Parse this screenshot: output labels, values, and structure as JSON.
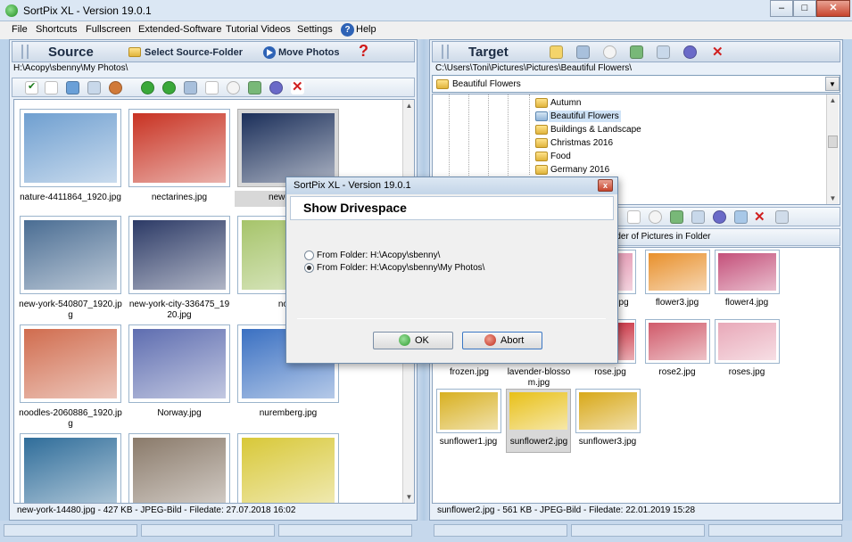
{
  "window": {
    "title": "SortPix XL - Version 19.0.1",
    "min_label": "–",
    "max_label": "□",
    "close_label": "✕"
  },
  "menu": {
    "items": [
      "File",
      "Shortcuts",
      "Fullscreen",
      "Extended-Software",
      "Tutorial Videos",
      "Settings",
      "Help"
    ],
    "help_icon_label": "?"
  },
  "source": {
    "title": "Source",
    "select_button": "Select Source-Folder",
    "move_button": "Move Photos",
    "question_label": "?",
    "path": "H:\\Acopy\\sbenny\\My Photos\\",
    "status": "new-york-14480.jpg - 427 KB - JPEG-Bild - Filedate: 27.07.2018 16:02",
    "thumbnails": [
      {
        "caption": "nature-4411864_1920.jpg",
        "color": "#6f9fd0"
      },
      {
        "caption": "nectarines.jpg",
        "color": "#c83222"
      },
      {
        "caption": "new-york-",
        "color": "#1b2f5a",
        "selected": true
      },
      {
        "caption": "new-york-540807_1920.jp g",
        "color": "#4a6d93"
      },
      {
        "caption": "new-york-city-336475_19 20.jpg",
        "color": "#2c3a66"
      },
      {
        "caption": "nood",
        "color": "#a6c46a"
      },
      {
        "caption": "noodles-2060886_1920.jp g",
        "color": "#d06c4e"
      },
      {
        "caption": "Norway.jpg",
        "color": "#5e6db0"
      },
      {
        "caption": "nuremberg.jpg",
        "color": "#3a70c2"
      },
      {
        "caption": "",
        "color": "#2f6d9a"
      },
      {
        "caption": "",
        "color": "#8a7a6a"
      },
      {
        "caption": "",
        "color": "#d8c838"
      }
    ]
  },
  "target": {
    "title": "Target",
    "path": "C:\\Users\\Toni\\Pictures\\Pictures\\Beautiful Flowers\\",
    "dropdown_value": "Beautiful Flowers",
    "tree_items": [
      "Autumn",
      "Beautiful Flowers",
      "Buildings & Landscape",
      "Christmas 2016",
      "Food",
      "Germany 2016"
    ],
    "order_label": "rder of Pictures in Folder",
    "status": "sunflower2.jpg - 561 KB - JPEG-Bild - Filedate: 22.01.2019 15:28",
    "thumbnails": [
      {
        "caption": "jpg",
        "color": "#e08aa8"
      },
      {
        "caption": "flower3.jpg",
        "color": "#e8902c"
      },
      {
        "caption": "flower4.jpg",
        "color": "#c4507a"
      },
      {
        "caption": "frozen.jpg",
        "color": "#8aa8c8"
      },
      {
        "caption": "lavender-blosso m.jpg",
        "color": "#8a6ab0"
      },
      {
        "caption": "rose.jpg",
        "color": "#c82a3a"
      },
      {
        "caption": "rose2.jpg",
        "color": "#d05a6a"
      },
      {
        "caption": "roses.jpg",
        "color": "#e8a8b8"
      },
      {
        "caption": "sunflower1.jpg",
        "color": "#d8b020"
      },
      {
        "caption": "sunflower2.jpg",
        "color": "#e8c018",
        "selected": true
      },
      {
        "caption": "sunflower3.jpg",
        "color": "#d8a818"
      }
    ]
  },
  "dialog": {
    "title": "SortPix XL - Version 19.0.1",
    "close_label": "x",
    "heading": "Show Drivespace",
    "option1": "From Folder: H:\\Acopy\\sbenny\\",
    "option2": "From Folder: H:\\Acopy\\sbenny\\My Photos\\",
    "ok_label": "OK",
    "abort_label": "Abort"
  },
  "colors": {
    "accent": "#2e63b6",
    "close_red": "#c7442d"
  }
}
